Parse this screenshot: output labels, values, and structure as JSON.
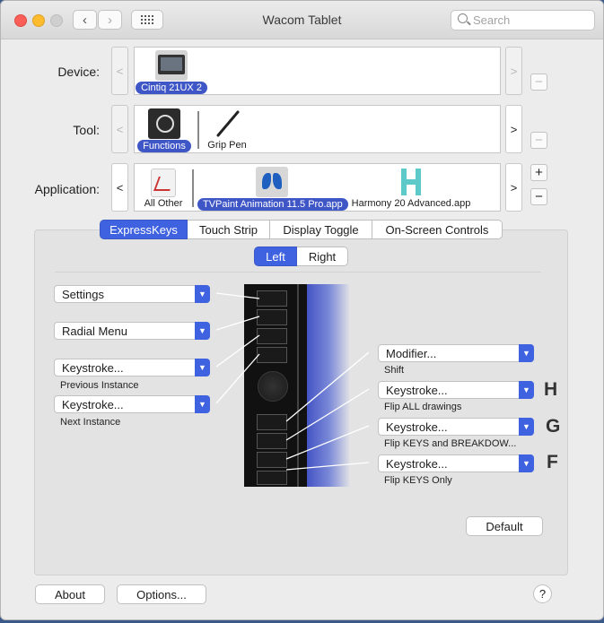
{
  "window": {
    "title": "Wacom Tablet"
  },
  "search": {
    "placeholder": "Search"
  },
  "device": {
    "label": "Device:",
    "items": [
      {
        "name": "Cintiq 21UX 2"
      }
    ]
  },
  "tool": {
    "label": "Tool:",
    "items": [
      {
        "name": "Functions"
      },
      {
        "name": "Grip Pen"
      }
    ]
  },
  "application": {
    "label": "Application:",
    "items": [
      {
        "name": "All Other"
      },
      {
        "name": "TVPaint Animation 11.5 Pro.app"
      },
      {
        "name": "Harmony 20 Advanced.app"
      }
    ]
  },
  "arrows": {
    "left": "<",
    "right": ">"
  },
  "buttons": {
    "plus": "+",
    "minus": "−",
    "default": "Default",
    "about": "About",
    "options": "Options...",
    "help": "?"
  },
  "tabs": [
    "ExpressKeys",
    "Touch Strip",
    "Display Toggle",
    "On-Screen Controls"
  ],
  "side": [
    "Left",
    "Right"
  ],
  "left_keys": [
    {
      "value": "Settings",
      "sub": ""
    },
    {
      "value": "Radial Menu",
      "sub": ""
    },
    {
      "value": "Keystroke...",
      "sub": "Previous Instance"
    },
    {
      "value": "Keystroke...",
      "sub": "Next Instance"
    }
  ],
  "right_keys": [
    {
      "value": "Modifier...",
      "sub": "Shift",
      "letter": ""
    },
    {
      "value": "Keystroke...",
      "sub": "Flip ALL drawings",
      "letter": "H"
    },
    {
      "value": "Keystroke...",
      "sub": "Flip KEYS and BREAKDOW...",
      "letter": "G"
    },
    {
      "value": "Keystroke...",
      "sub": "Flip KEYS Only",
      "letter": "F"
    }
  ],
  "colors": {
    "selection": "#3f62e0",
    "pill": "#3f56c7"
  }
}
